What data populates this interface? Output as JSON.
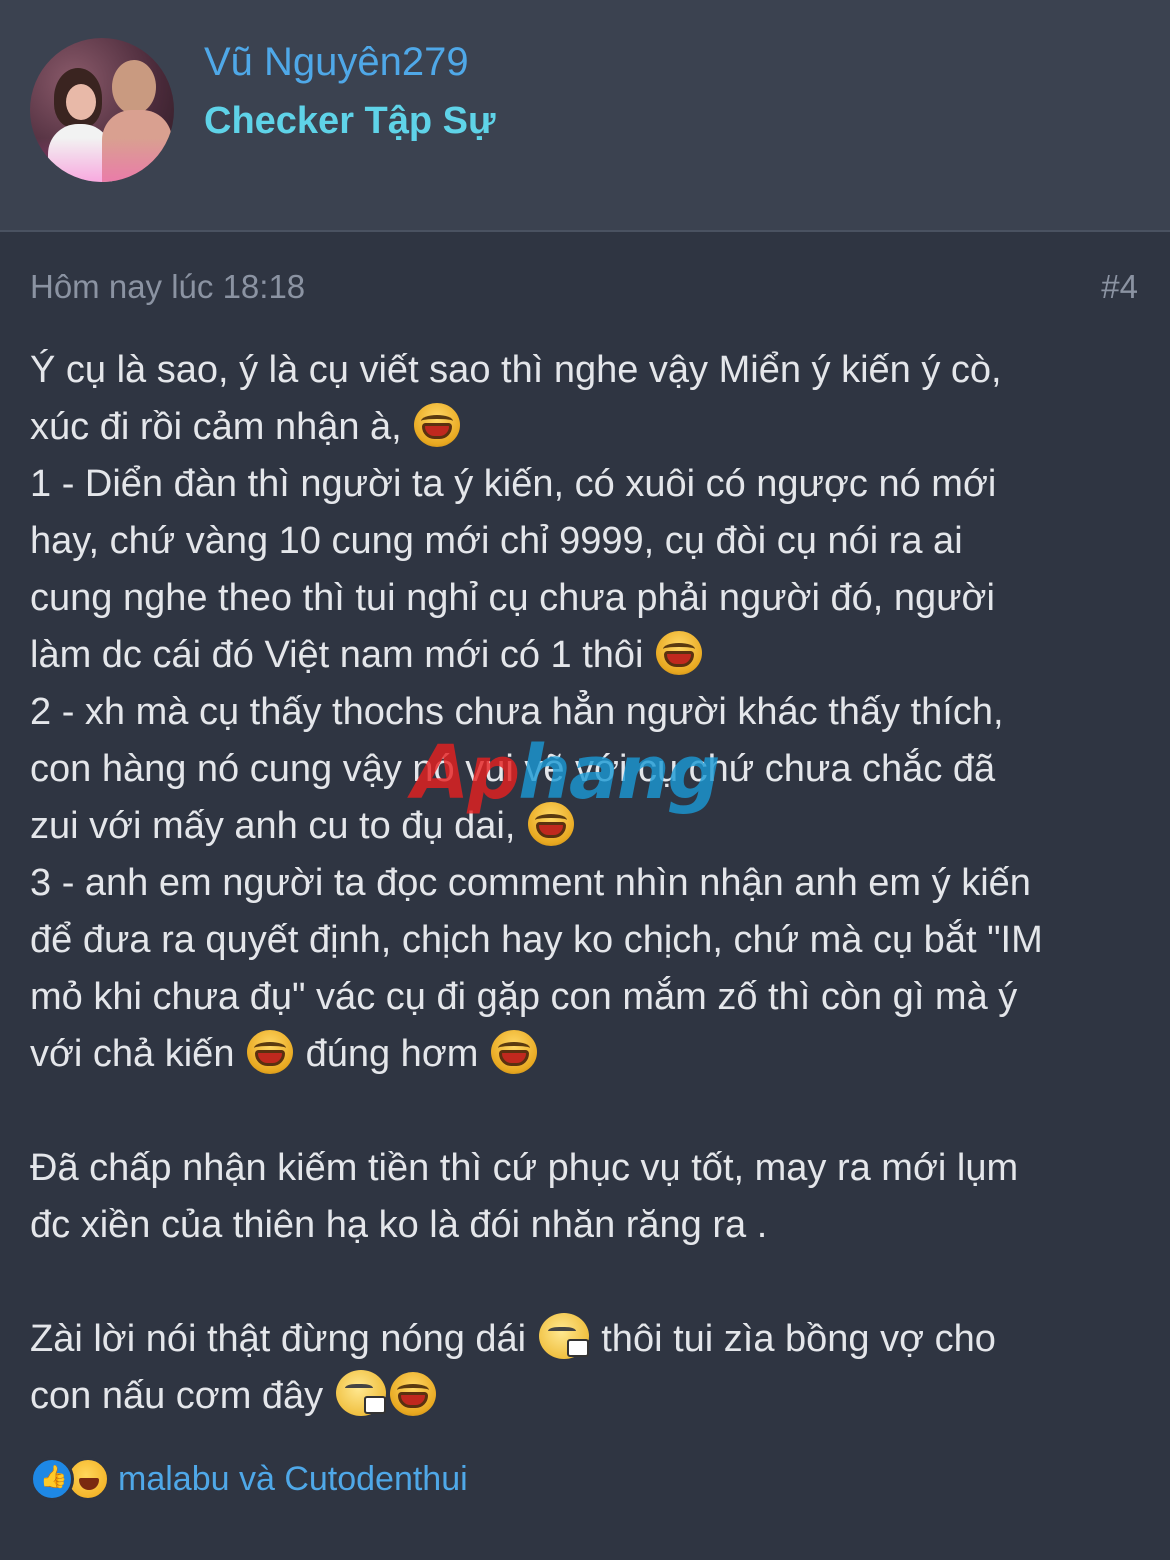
{
  "user": {
    "name": "Vũ Nguyên279",
    "title": "Checker Tập Sự"
  },
  "post": {
    "time": "Hôm nay lúc 18:18",
    "number": "#4",
    "lines": [
      "Ý cụ là sao, ý là cụ viết sao thì nghe vậy Miển ý kiến ý cò,",
      "xúc đi rồi cảm nhận à,",
      "1 - Diển đàn thì người ta ý kiến, có xuôi có ngược nó mới",
      "hay, chứ vàng 10 cung mới chỉ 9999, cụ đòi cụ nói ra ai",
      "cung nghe theo thì tui nghỉ cụ chưa phải người đó, người",
      "làm dc cái đó Việt nam mới có 1 thôi",
      "2 - xh mà cụ thấy thochs chưa hẳn người khác thấy thích,",
      "con hàng nó cung vậy nó vui vẽ với cụ chứ chưa chắc đã",
      "zui với mấy anh cu to đụ dai,",
      "3 - anh em người ta đọc comment nhìn nhận anh em ý kiến",
      "để đưa ra quyết định, chịch hay ko chịch, chứ mà cụ bắt \"IM",
      "mỏ khi chưa đụ\" vác cụ đi gặp con mắm zố thì còn gì mà ý",
      "với chả kiến",
      "đúng hơm",
      "Đã chấp nhận kiếm tiền thì cứ phục vụ tốt, may ra mới lụm",
      "đc xiền của thiên hạ ko là đói nhăn răng ra .",
      "Zài lời nói thật đừng nóng dái",
      "thôi tui zìa bồng vợ cho",
      "con nấu cơm đây"
    ]
  },
  "watermark": {
    "part1": "Ap",
    "part2": "hang"
  },
  "reactions": {
    "icons": [
      "like-icon",
      "laugh-icon"
    ],
    "names": "malabu và Cutodenthui"
  },
  "colors": {
    "background": "#2f3542",
    "header": "#3b4250",
    "link": "#4fa8e8",
    "title": "#5fd3e8"
  }
}
